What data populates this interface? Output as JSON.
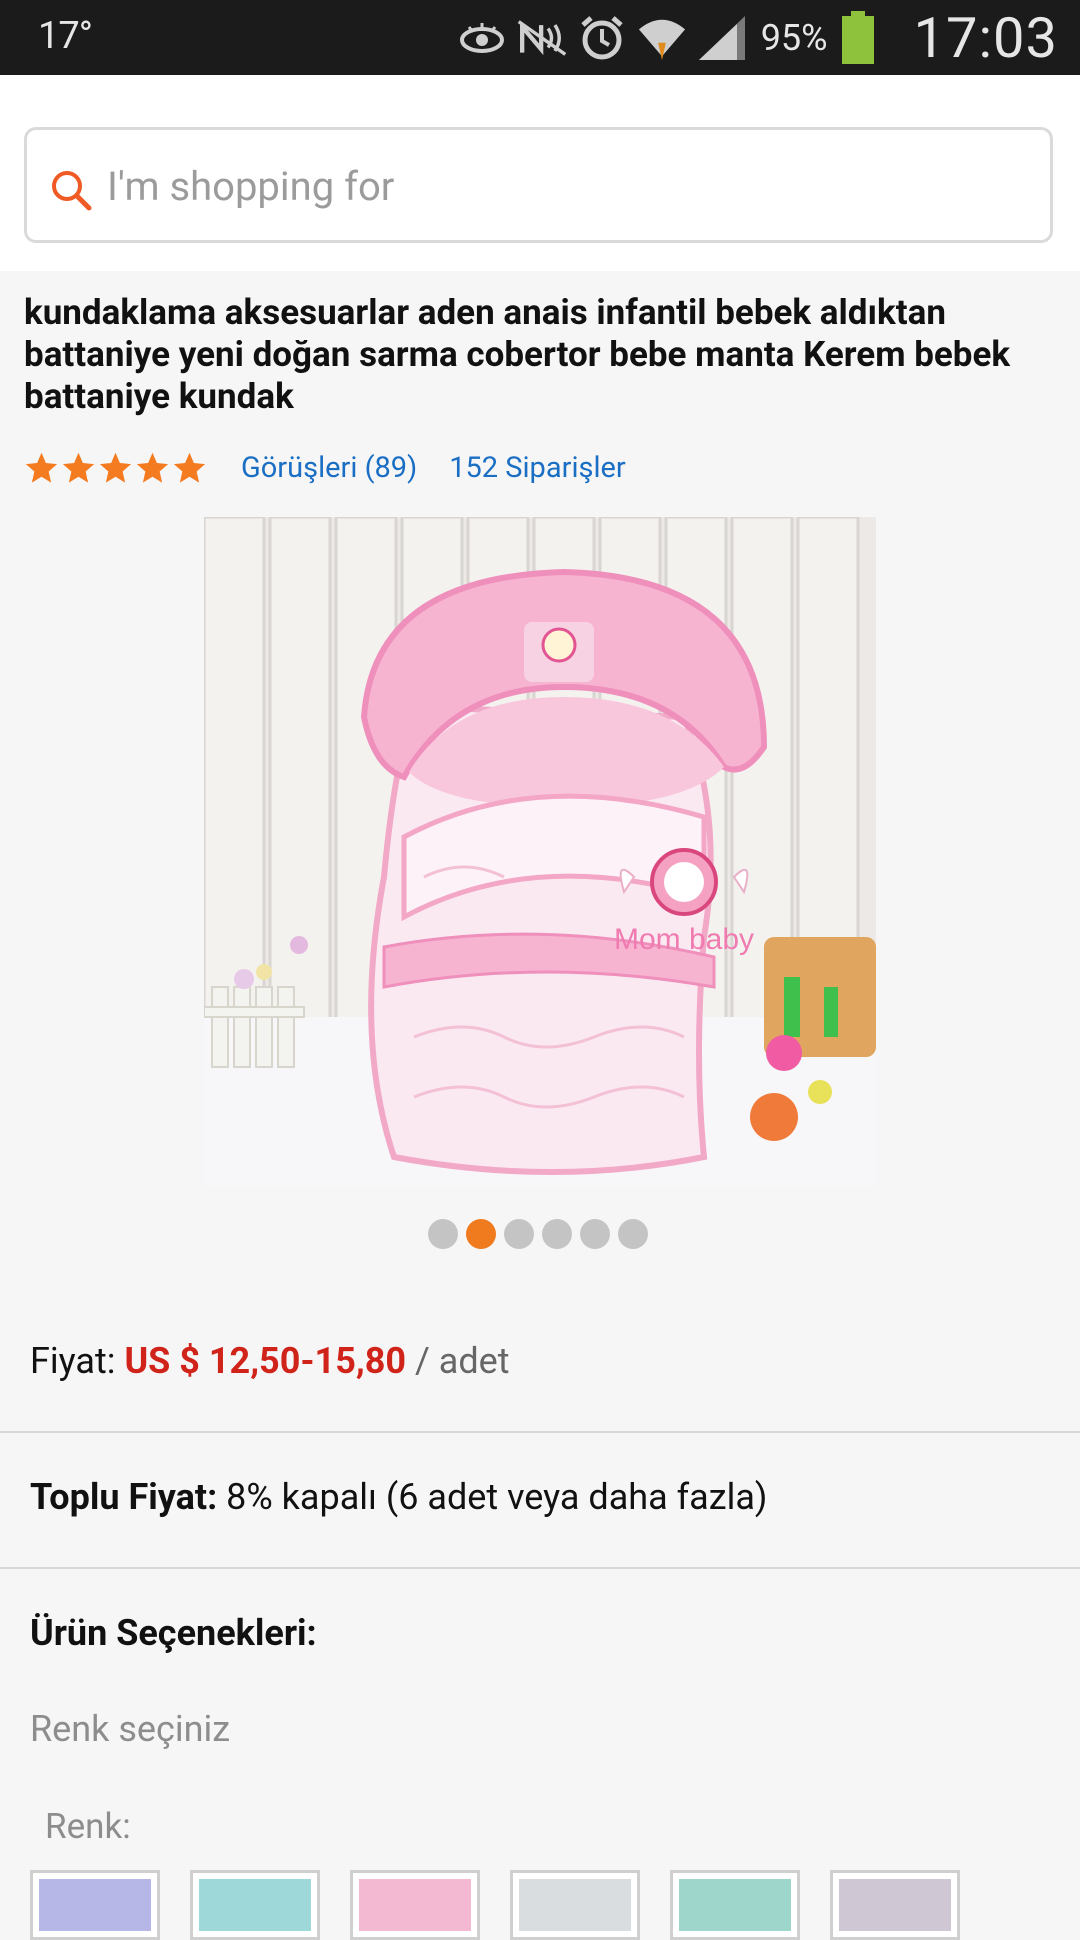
{
  "status_bar": {
    "temperature": "17°",
    "battery": "95%",
    "time": "17:03",
    "icons": [
      "eye-icon",
      "nfc-icon",
      "alarm-icon",
      "wifi-icon",
      "signal-icon",
      "battery-icon"
    ]
  },
  "search": {
    "placeholder": "I'm shopping for"
  },
  "product": {
    "title": "kundaklama aksesuarlar aden anais infantil bebek aldıktan battaniye yeni doğan sarma cobertor bebe manta Kerem bebek battaniye kundak",
    "rating_stars": 5,
    "reviews": "Görüşleri (89)",
    "orders": "152 Siparişler",
    "image_text": "Mom baby",
    "gallery_total": 6,
    "gallery_active_index": 1
  },
  "price": {
    "label": "Fiyat:",
    "value": "US $ 12,50-15,80",
    "unit": " / adet"
  },
  "bulk": {
    "label": "Toplu Fiyat:",
    "value": " 8% kapalı (6 adet veya daha fazla)"
  },
  "options": {
    "title": "Ürün Seçenekleri:",
    "prompt": "Renk seçiniz",
    "color_label": "Renk:",
    "swatch_colors": [
      "#b6b7e6",
      "#9fd8d9",
      "#f3b9d2",
      "#d9dde0",
      "#9fd6cc",
      "#cfc8d4"
    ]
  },
  "colors": {
    "accent_orange": "#f07a1e",
    "price_red": "#d0241b",
    "link_blue": "#1a6ec4"
  }
}
